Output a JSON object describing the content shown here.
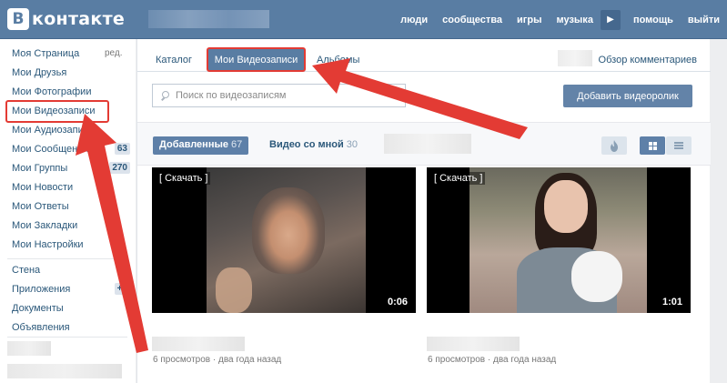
{
  "header": {
    "logo_letter": "В",
    "logo_text": "контакте",
    "nav": [
      "люди",
      "сообщества",
      "игры",
      "музыка",
      "помощь",
      "выйти"
    ]
  },
  "sidebar": {
    "edit_label": "ред.",
    "items": [
      {
        "label": "Моя Страница"
      },
      {
        "label": "Мои Друзья"
      },
      {
        "label": "Мои Фотографии"
      },
      {
        "label": "Мои Видеозаписи"
      },
      {
        "label": "Мои Аудиозаписи"
      },
      {
        "label": "Мои Сообщения",
        "badge": "63"
      },
      {
        "label": "Мои Группы",
        "badge": "270"
      },
      {
        "label": "Мои Новости"
      },
      {
        "label": "Мои Ответы"
      },
      {
        "label": "Мои Закладки"
      },
      {
        "label": "Мои Настройки"
      }
    ],
    "extra_items": [
      {
        "label": "Стена"
      },
      {
        "label": "Приложения",
        "badge": "+2"
      },
      {
        "label": "Документы"
      },
      {
        "label": "Объявления"
      }
    ]
  },
  "tabs": {
    "catalog": "Каталог",
    "my_videos": "Мои Видеозаписи",
    "albums": "Альбомы",
    "comments_overview": "Обзор комментариев"
  },
  "search": {
    "placeholder": "Поиск по видеозаписям"
  },
  "add_button": "Добавить видеоролик",
  "filters": {
    "added_label": "Добавленные",
    "added_count": "67",
    "with_me_label": "Видео со мной",
    "with_me_count": "30"
  },
  "videos": [
    {
      "download": "[ Скачать ]",
      "duration": "0:06",
      "meta": "6 просмотров · два года назад"
    },
    {
      "download": "[ Скачать ]",
      "duration": "1:01",
      "meta": "6 просмотров · два года назад"
    }
  ],
  "colors": {
    "header": "#597da3",
    "accent_button": "#6383a8",
    "highlight_annotation": "#e33b34",
    "link": "#2b587a"
  }
}
